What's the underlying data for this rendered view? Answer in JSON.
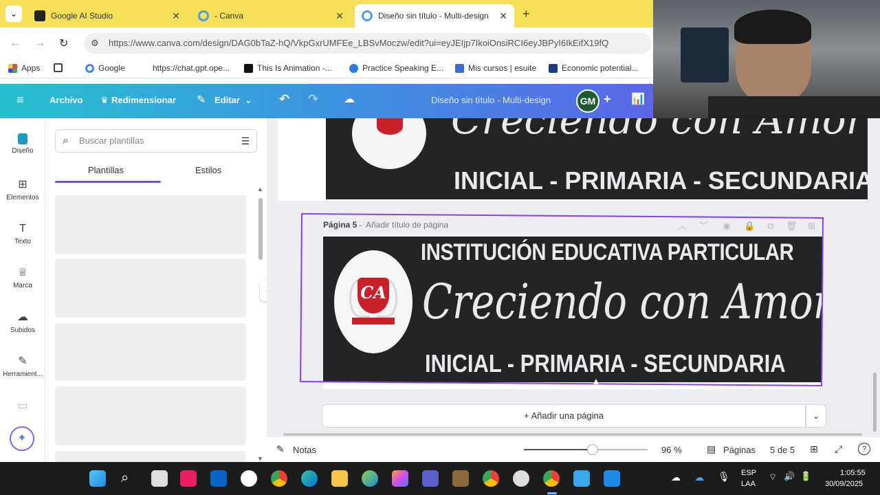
{
  "browser": {
    "tabs": [
      {
        "title": "Google AI Studio",
        "color": "#222222"
      },
      {
        "title": "- Canva",
        "color": "#4aa0e0"
      },
      {
        "title": "Diseño sin título - Multi-design",
        "color": "#4aa0e0"
      }
    ],
    "new_tab": "+",
    "url": "https://www.canva.com/design/DAG0bTaZ-hQ/VkpGxrUMFEe_LBSvMoczw/edit?ui=eyJEIjp7IkoiOnsiRCI6eyJBPyI6IkEifX19fQ",
    "bookmarks": [
      "Apps",
      "Google",
      "https://chat.gpt.ope...",
      "This Is Animation -...",
      "Practice Speaking E...",
      "Mis cursos | esuite",
      "Economic potential..."
    ]
  },
  "canva": {
    "menu": [
      "Archivo",
      "Redimensionar",
      "Editar"
    ],
    "doc_title": "Diseño sin título - Multi-design",
    "avatar": "GM",
    "rail": [
      "Diseño",
      "Elementos",
      "Texto",
      "Marca",
      "Subidos",
      "Herramient..."
    ],
    "search_placeholder": "Buscar plantillas",
    "panel_tabs": [
      "Plantillas",
      "Estilos"
    ],
    "page_label": "Página 5",
    "page_title_hint": "Añadir título de página",
    "banner": {
      "line1": "INSTITUCIÓN EDUCATIVA PARTICULAR",
      "line2": "Creciendo con Amor",
      "line3": "INICIAL - PRIMARIA - SECUNDARIA",
      "logo": "CA",
      "partial_line2": "Creciendo con Amor",
      "partial_line3": "INICIAL - PRIMARIA - SECUNDARIA"
    },
    "add_page": "+ Añadir una página",
    "notes": "Notas",
    "zoom": "96 %",
    "pages_label": "Páginas",
    "page_count": "5 de 5"
  },
  "taskbar": {
    "lang": "ESP",
    "lang2": "LAA",
    "time": "1:05:55",
    "date": "30/09/2025"
  }
}
